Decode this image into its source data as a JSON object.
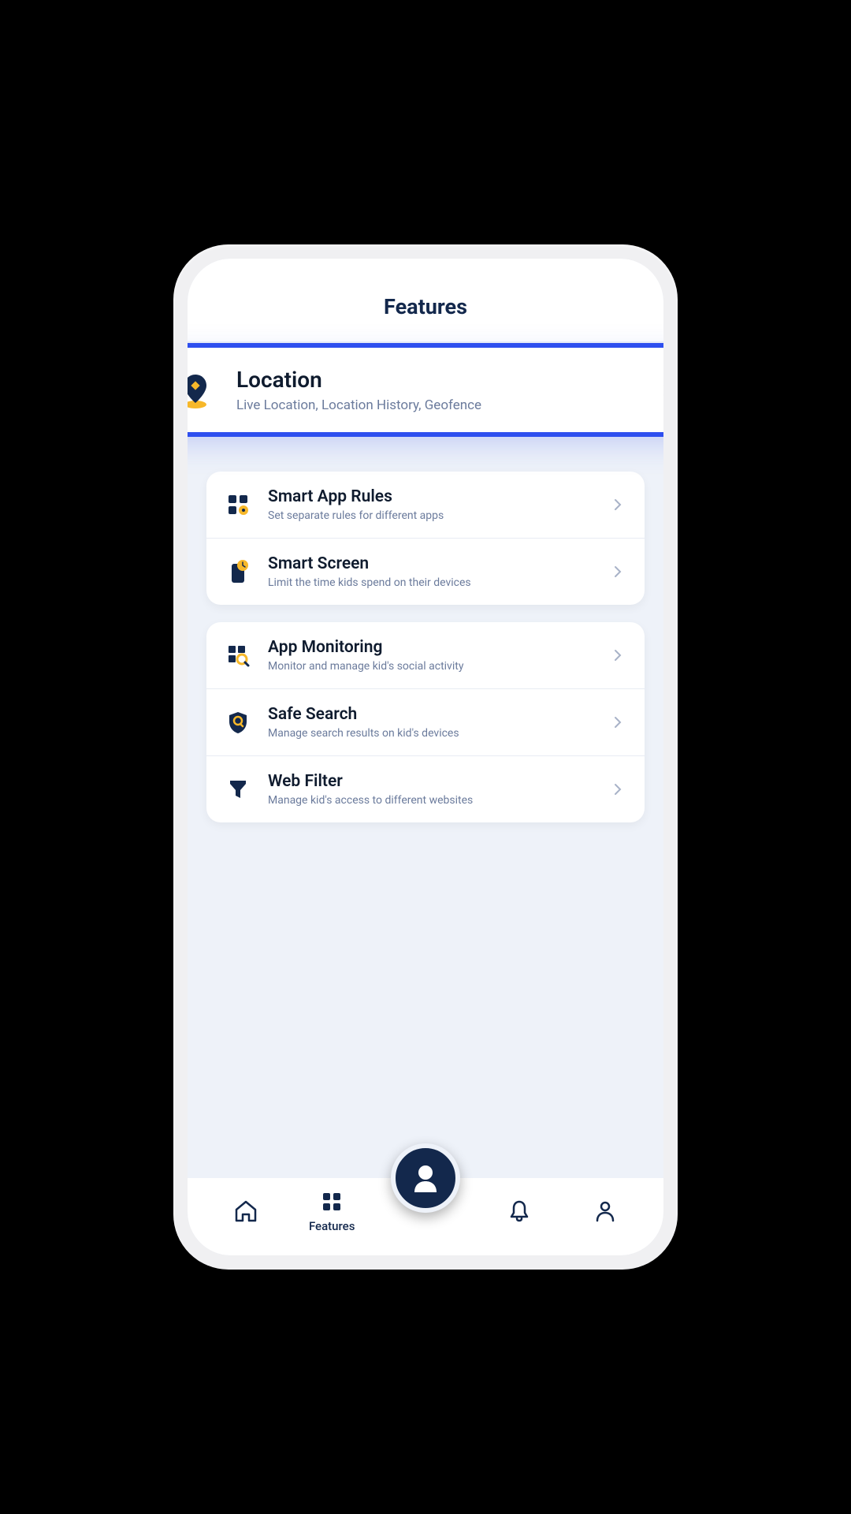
{
  "header": {
    "title": "Features"
  },
  "highlighted": {
    "title": "Location",
    "subtitle": "Live Location, Location History, Geofence"
  },
  "group1": [
    {
      "title": "Smart App Rules",
      "subtitle": "Set separate rules for different apps"
    },
    {
      "title": "Smart Screen",
      "subtitle": "Limit the time kids spend on their devices"
    }
  ],
  "group2": [
    {
      "title": "App Monitoring",
      "subtitle": "Monitor and manage kid's social activity"
    },
    {
      "title": "Safe Search",
      "subtitle": "Manage search results on kid's devices"
    },
    {
      "title": "Web Filter",
      "subtitle": "Manage kid's access to different websites"
    }
  ],
  "nav": {
    "features_label": "Features"
  },
  "colors": {
    "navy": "#13284c",
    "yellow": "#f7b82a",
    "blue_highlight": "#2e4fef",
    "grey_text": "#6b7b9c"
  }
}
